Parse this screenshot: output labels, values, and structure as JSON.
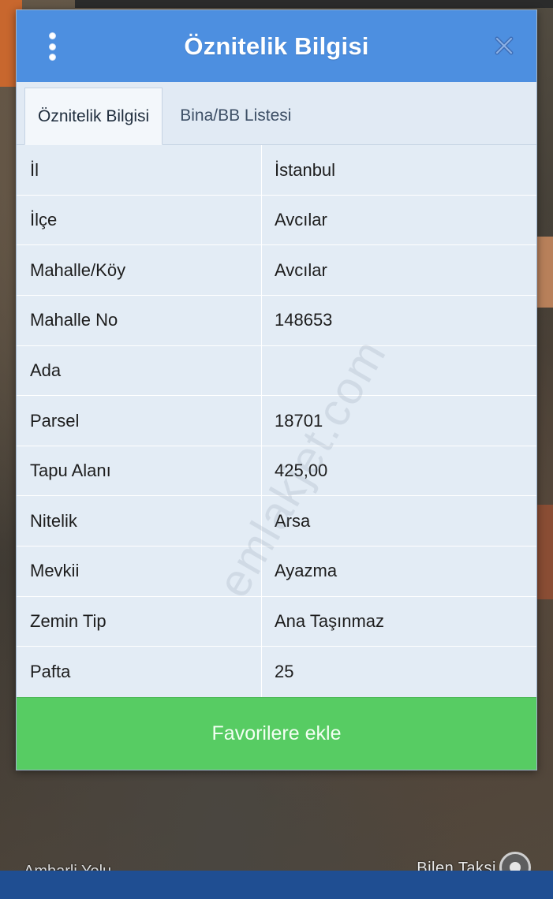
{
  "dialog": {
    "title": "Öznitelik Bilgisi"
  },
  "tabs": [
    {
      "label": "Öznitelik Bilgisi",
      "active": true
    },
    {
      "label": "Bina/BB Listesi",
      "active": false
    }
  ],
  "attributes": [
    {
      "key": "İl",
      "value": "İstanbul"
    },
    {
      "key": "İlçe",
      "value": "Avcılar"
    },
    {
      "key": "Mahalle/Köy",
      "value": "Avcılar"
    },
    {
      "key": "Mahalle No",
      "value": "148653"
    },
    {
      "key": "Ada",
      "value": ""
    },
    {
      "key": "Parsel",
      "value": "18701"
    },
    {
      "key": "Tapu Alanı",
      "value": "425,00"
    },
    {
      "key": "Nitelik",
      "value": "Arsa"
    },
    {
      "key": "Mevkii",
      "value": "Ayazma"
    },
    {
      "key": "Zemin Tip",
      "value": "Ana Taşınmaz"
    },
    {
      "key": "Pafta",
      "value": "25"
    }
  ],
  "favorite_button": {
    "label": "Favorilere ekle"
  },
  "watermark": "emlakjet.com",
  "map": {
    "label_right": "Bilen Taksi",
    "label_left": "Ambarli Yolu"
  },
  "colors": {
    "header": "#4d8fe0",
    "button": "#57cc63",
    "table_bg": "#e3ecf5"
  },
  "icons": {
    "menu": "vertical-dots-icon",
    "close": "close-icon",
    "location": "my-location-icon"
  }
}
